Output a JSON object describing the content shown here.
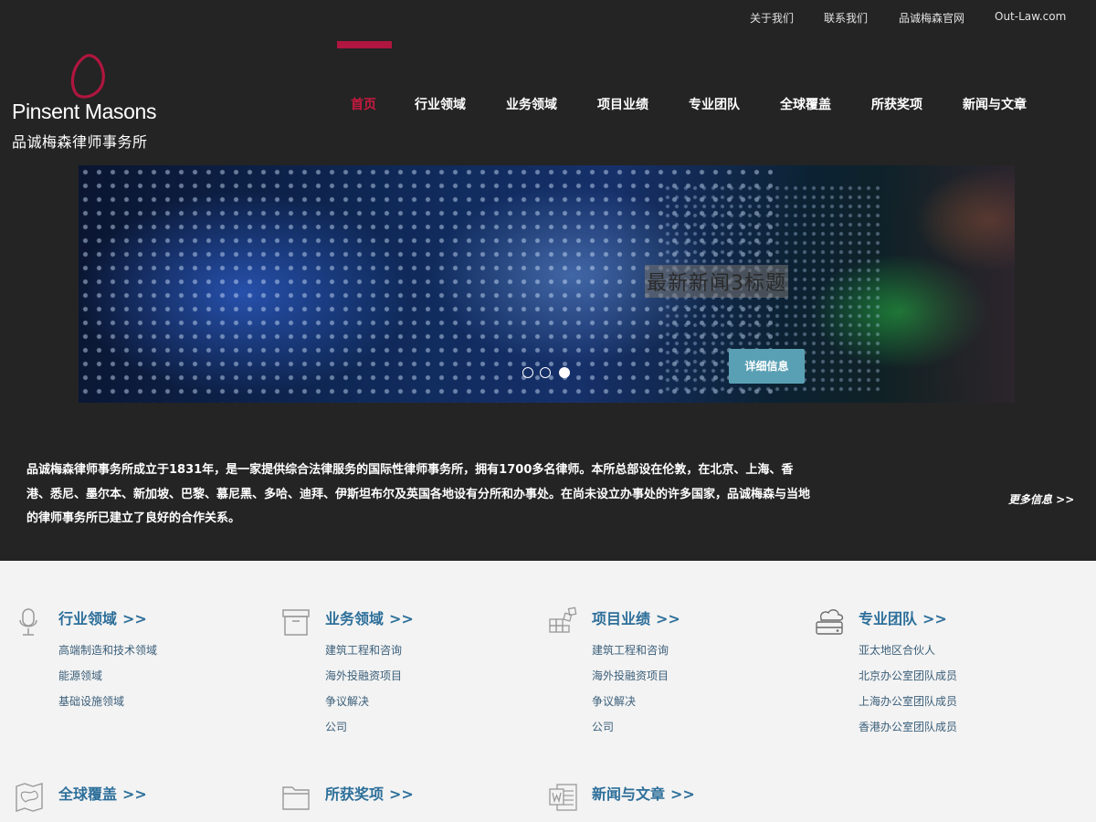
{
  "top_links": [
    "关于我们",
    "联系我们",
    "品诚梅森官网",
    "Out-Law.com"
  ],
  "logo": {
    "name": "Pinsent Masons",
    "subtitle": "品诚梅森律师事务所"
  },
  "nav": [
    "首页",
    "行业领域",
    "业务领域",
    "项目业绩",
    "专业团队",
    "全球覆盖",
    "所获奖项",
    "新闻与文章"
  ],
  "nav_active_index": 0,
  "colors": {
    "accent": "#b0163f",
    "link": "#2d6f9a",
    "button": "#5aa0b4",
    "dark_bg": "#242424",
    "light_bg": "#f3f3f3"
  },
  "hero": {
    "title": "最新新闻3标题",
    "button": "详细信息",
    "slide_count": 3,
    "active_slide": 3
  },
  "intro": {
    "text": "品诚梅森律师事务所成立于1831年，是一家提供综合法律服务的国际性律师事务所，拥有1700多名律师。本所总部设在伦敦，在北京、上海、香港、悉尼、墨尔本、新加坡、巴黎、慕尼黑、多哈、迪拜、伊斯坦布尔及英国各地设有分所和办事处。在尚未设立办事处的许多国家，品诚梅森与当地的律师事务所已建立了良好的合作关系。",
    "more": "更多信息 >>"
  },
  "sections": [
    {
      "title": "行业领域",
      "arrow": ">>",
      "icon": "microphone-icon",
      "items": [
        "高端制造和技术领域",
        "能源领域",
        "基础设施领域"
      ]
    },
    {
      "title": "业务领域",
      "arrow": ">>",
      "icon": "archive-box-icon",
      "items": [
        "建筑工程和咨询",
        "海外投融资项目",
        "争议解决",
        "公司"
      ]
    },
    {
      "title": "项目业绩",
      "arrow": ">>",
      "icon": "blocks-icon",
      "items": [
        "建筑工程和咨询",
        "海外投融资项目",
        "争议解决",
        "公司"
      ]
    },
    {
      "title": "专业团队",
      "arrow": ">>",
      "icon": "cloud-server-icon",
      "items": [
        "亚太地区合伙人",
        "北京办公室团队成员",
        "上海办公室团队成员",
        "香港办公室团队成员"
      ]
    },
    {
      "title": "全球覆盖",
      "arrow": ">>",
      "icon": "map-icon",
      "items": []
    },
    {
      "title": "所获奖项",
      "arrow": ">>",
      "icon": "folder-icon",
      "items": []
    },
    {
      "title": "新闻与文章",
      "arrow": ">>",
      "icon": "word-document-icon",
      "items": []
    }
  ]
}
